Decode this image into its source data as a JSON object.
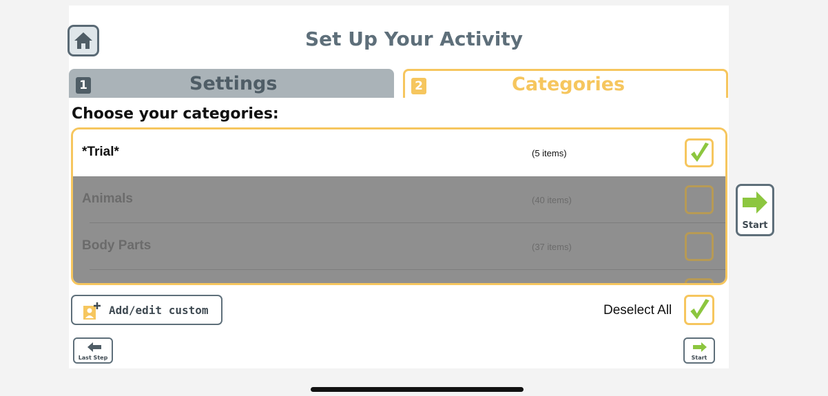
{
  "header": {
    "title": "Set Up Your Activity"
  },
  "tabs": [
    {
      "number": "1",
      "label": "Settings",
      "active": false
    },
    {
      "number": "2",
      "label": "Categories",
      "active": true
    }
  ],
  "categories": {
    "heading": "Choose your categories:",
    "items": [
      {
        "name": "*Trial*",
        "count": "(5 items)",
        "checked": true
      },
      {
        "name": "Animals",
        "count": "(40 items)",
        "checked": false
      },
      {
        "name": "Body Parts",
        "count": "(37 items)",
        "checked": false
      }
    ]
  },
  "actions": {
    "add_edit_custom": "Add/edit custom",
    "deselect_all": "Deselect All",
    "last_step": "Last Step",
    "start": "Start"
  },
  "colors": {
    "accent": "#f6c65e",
    "check_green": "#8cc63f",
    "title_gray": "#5e6f7a",
    "tab_inactive": "#aab3b8",
    "disabled_overlay": "#8f8f8f"
  },
  "icons": {
    "home": "home-icon",
    "check": "check-icon",
    "arrow_right": "arrow-right-icon",
    "arrow_left": "arrow-left-icon",
    "add_custom": "person-plus-icon"
  }
}
